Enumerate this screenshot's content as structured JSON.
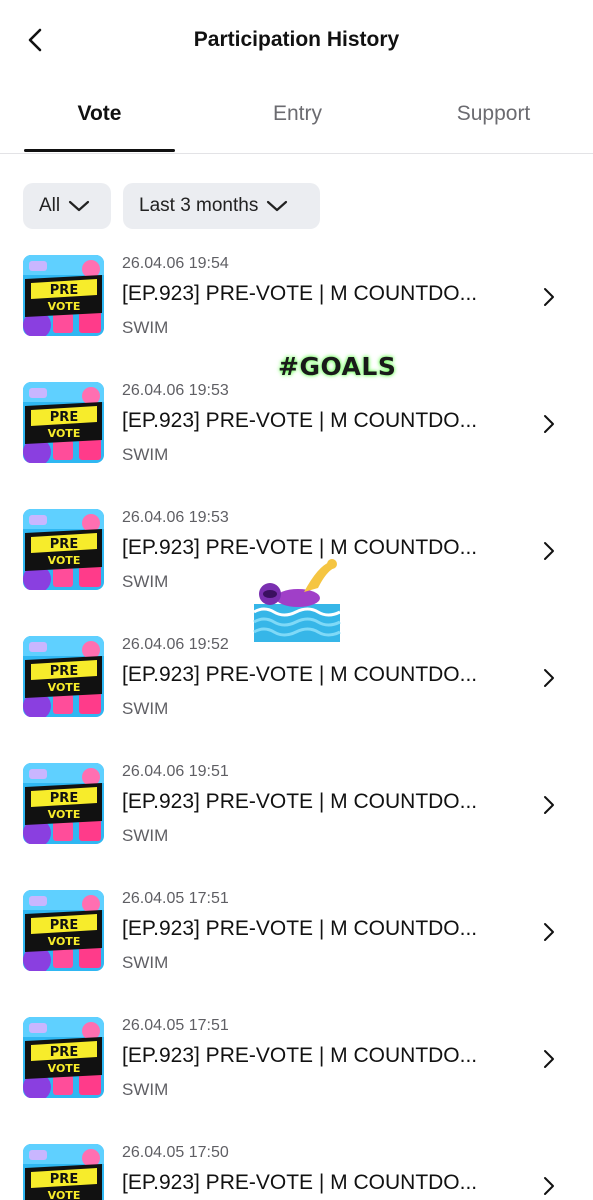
{
  "header": {
    "title": "Participation History",
    "back_icon": "chevron-left-icon"
  },
  "tabs": [
    {
      "label": "Vote",
      "active": true
    },
    {
      "label": "Entry",
      "active": false
    },
    {
      "label": "Support",
      "active": false
    }
  ],
  "filters": [
    {
      "label": "All",
      "icon": "chevron-down-icon"
    },
    {
      "label": "Last 3 months",
      "icon": "chevron-down-icon"
    }
  ],
  "items": [
    {
      "date": "26.04.06 19:54",
      "title": "[EP.923] PRE-VOTE | M COUNTDO...",
      "artist": "SWIM",
      "thumb_top": "PRE",
      "thumb_bottom": "VOTE"
    },
    {
      "date": "26.04.06 19:53",
      "title": "[EP.923] PRE-VOTE | M COUNTDO...",
      "artist": "SWIM",
      "thumb_top": "PRE",
      "thumb_bottom": "VOTE"
    },
    {
      "date": "26.04.06 19:53",
      "title": "[EP.923] PRE-VOTE | M COUNTDO...",
      "artist": "SWIM",
      "thumb_top": "PRE",
      "thumb_bottom": "VOTE"
    },
    {
      "date": "26.04.06 19:52",
      "title": "[EP.923] PRE-VOTE | M COUNTDO...",
      "artist": "SWIM",
      "thumb_top": "PRE",
      "thumb_bottom": "VOTE"
    },
    {
      "date": "26.04.06 19:51",
      "title": "[EP.923] PRE-VOTE | M COUNTDO...",
      "artist": "SWIM",
      "thumb_top": "PRE",
      "thumb_bottom": "VOTE"
    },
    {
      "date": "26.04.05 17:51",
      "title": "[EP.923] PRE-VOTE | M COUNTDO...",
      "artist": "SWIM",
      "thumb_top": "PRE",
      "thumb_bottom": "VOTE"
    },
    {
      "date": "26.04.05 17:51",
      "title": "[EP.923] PRE-VOTE | M COUNTDO...",
      "artist": "SWIM",
      "thumb_top": "PRE",
      "thumb_bottom": "VOTE"
    },
    {
      "date": "26.04.05 17:50",
      "title": "[EP.923] PRE-VOTE | M COUNTDO...",
      "artist": "SWIM",
      "thumb_top": "PRE",
      "thumb_bottom": "VOTE"
    }
  ],
  "stickers": {
    "goals_text": "#GOALS",
    "swim_icon": "swimmer-icon"
  },
  "colors": {
    "active_tab": "#111111",
    "inactive_tab": "#6b6b70",
    "chip_bg": "#ebedf1",
    "thumb_bg": "#2fb7f2",
    "thumb_banner": "#f7ec2b"
  }
}
